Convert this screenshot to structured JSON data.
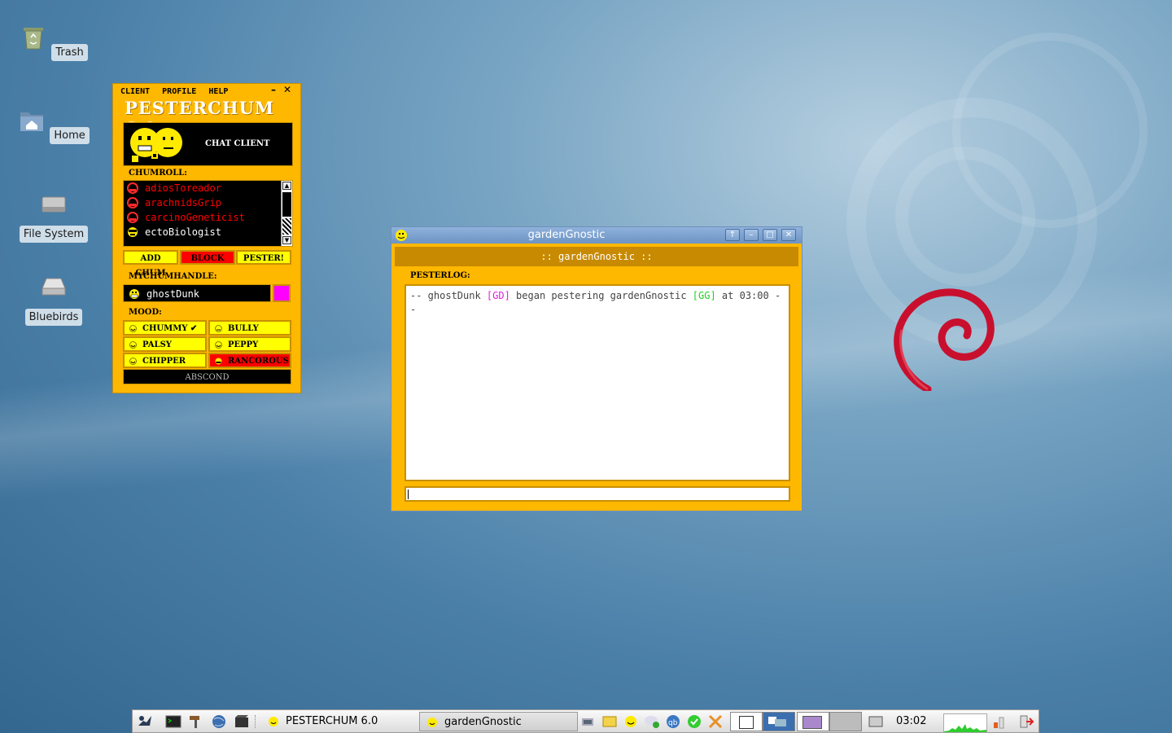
{
  "desktop": {
    "icons": [
      {
        "label": "Trash"
      },
      {
        "label": "Home"
      },
      {
        "label": "File System"
      },
      {
        "label": "Bluebirds"
      }
    ]
  },
  "pesterchum": {
    "menu": {
      "client": "CLIENT",
      "profile": "PROFILE",
      "help": "HELP"
    },
    "minimize": "–",
    "close": "✕",
    "title": "PESTERCHUM 6.0",
    "banner_text": "CHAT CLIENT",
    "chumroll_label": "CHUMROLL:",
    "chums": [
      {
        "handle": "adiosToreador",
        "color": "#ff0000"
      },
      {
        "handle": "arachnidsGrip",
        "color": "#ff0000"
      },
      {
        "handle": "carcinoGeneticist",
        "color": "#ff0000"
      },
      {
        "handle": "ectoBiologist",
        "color": "#ffffff"
      }
    ],
    "buttons": {
      "add": "ADD CHUM",
      "block": "BLOCK",
      "pester": "PESTER!"
    },
    "mychumhandle_label": "MYCHUMHANDLE:",
    "my_handle": "ghostDunk",
    "my_color": "#ff00ff",
    "mood_label": "MOOD:",
    "moods": {
      "chummy": "CHUMMY ✔",
      "bully": "BULLY",
      "palsy": "PALSY",
      "peppy": "PEPPY",
      "chipper": "CHIPPER",
      "rancorous": "RANCOROUS"
    },
    "abscond": "ABSCOND"
  },
  "chat": {
    "window_title": "gardenGnostic",
    "header": ":: gardenGnostic ::",
    "pesterlog_label": "PESTERLOG:",
    "log": {
      "p1": "-- ghostDunk ",
      "tag1": "[GD]",
      "p2": " began pestering gardenGnostic ",
      "tag2": "[GG]",
      "p3": " at 03:00 --"
    },
    "input_value": ""
  },
  "taskbar": {
    "tasks": [
      {
        "label": "PESTERCHUM 6.0"
      },
      {
        "label": "gardenGnostic"
      }
    ],
    "clock": "03:02"
  }
}
